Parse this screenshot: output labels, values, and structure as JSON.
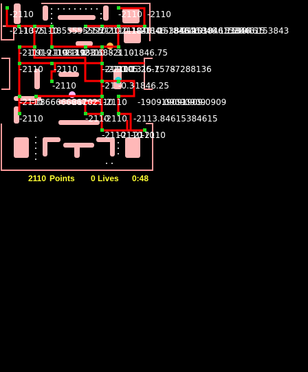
{
  "hud": {
    "score_value": "2110",
    "score_label": "Points",
    "lives": "0 Lives",
    "timer": "0:48"
  },
  "overlay_labels": [
    "-2110",
    "-2110",
    "-2110",
    "-2110",
    "-1375",
    "-2110",
    "-1855555555",
    "-2110",
    "-2110",
    "-2110",
    "-2110",
    "-1846",
    "-2110",
    "-1846.153846",
    "-1538461",
    "-1846.15384615384615",
    "-2110",
    "-1846.153846",
    "-1846.153846153843",
    "-2110",
    "-1919.1",
    "-2110",
    "-1983.1",
    "-2110",
    "-1983.1",
    "-2110",
    "-1688.3",
    "-2110",
    "-1846.75",
    "-2110",
    "-2110",
    "-2110",
    "-2110",
    "-2110",
    "-1105.26",
    "-1315.7",
    "-1578",
    "-7288136",
    "-2110",
    "-21",
    "-0.3",
    "-1846.25",
    "-2110",
    "-1866666667",
    "-2110",
    "-2110",
    "-2110",
    "-1909.0909",
    "-1909.0909",
    "-1909.0909",
    "-2110",
    "-2110",
    "-2110",
    "-2113.84615384615",
    "-2110",
    "-2110",
    "-2110",
    "-2110"
  ],
  "colors": {
    "wall_outline": "#ff9c9c",
    "wall_fill": "#ffb8b8",
    "path_line": "#ff0000",
    "node_marker": "#22dd22",
    "pellet": "#ffffff",
    "hud_text": "#ffff33",
    "overlay_text": "#ffffff"
  }
}
